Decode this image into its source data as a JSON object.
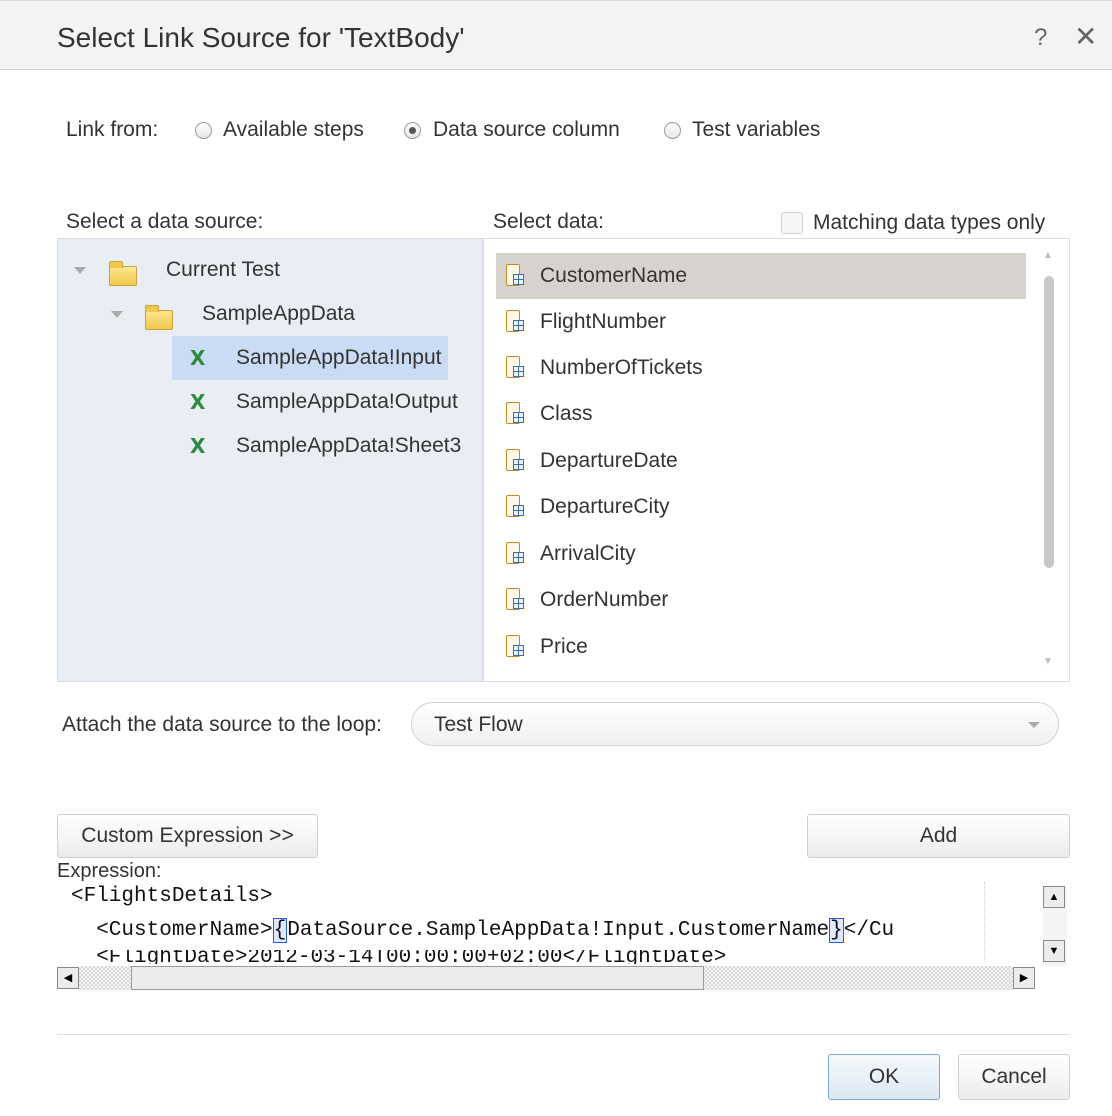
{
  "dialog": {
    "title": "Select Link Source for 'TextBody'",
    "help_glyph": "?",
    "close_glyph": "✕"
  },
  "link_from": {
    "label": "Link from:",
    "options": [
      "Available steps",
      "Data source column",
      "Test variables"
    ],
    "selected": "Data source column"
  },
  "data_source": {
    "label": "Select a data source:",
    "tree": [
      {
        "label": "Current Test",
        "icon": "folder-icon",
        "expanded": true
      },
      {
        "label": "SampleAppData",
        "icon": "folder-icon",
        "expanded": true
      },
      {
        "label": "SampleAppData!Input",
        "icon": "excel-icon",
        "selected": true
      },
      {
        "label": "SampleAppData!Output",
        "icon": "excel-icon"
      },
      {
        "label": "SampleAppData!Sheet3",
        "icon": "excel-icon"
      }
    ]
  },
  "select_data": {
    "label": "Select data:",
    "matching_label": "Matching data types only",
    "matching_checked": false,
    "items": [
      "CustomerName",
      "FlightNumber",
      "NumberOfTickets",
      "Class",
      "DepartureDate",
      "DepartureCity",
      "ArrivalCity",
      "OrderNumber",
      "Price"
    ],
    "selected": "CustomerName"
  },
  "loop": {
    "label": "Attach the data source to the loop:",
    "value": "Test Flow"
  },
  "buttons": {
    "custom_expression": "Custom Expression >>",
    "add": "Add",
    "ok": "OK",
    "cancel": "Cancel"
  },
  "expression": {
    "label": "Expression:",
    "line1": "<FlightsDetails>",
    "line2_prefix": "  <CustomerName>",
    "line2_open": "{",
    "line2_body": "DataSource.SampleAppData!Input.CustomerName",
    "line2_close": "}",
    "line2_suffix": "</Cu",
    "line3": "  <FlightDate>2012-03-14T00:00:00+02:00</FlightDate>"
  },
  "colors": {
    "tree_bg": "#e8eef4",
    "tree_selected": "#c9dcf3",
    "list_selected": "#d6d3cf",
    "ok_border": "#7aa7d8"
  }
}
